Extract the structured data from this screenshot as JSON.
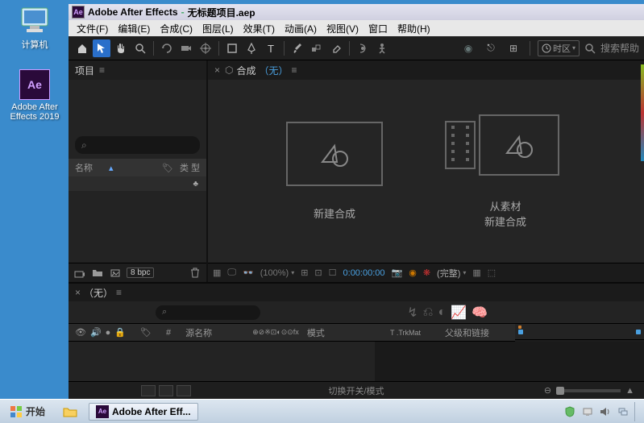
{
  "desktop": {
    "computer_label": "计算机",
    "ae_label": "Adobe After\nEffects 2019"
  },
  "titlebar": {
    "app": "Adobe After Effects",
    "sep": "-",
    "file": "无标题项目.aep"
  },
  "menu": {
    "file": "文件(F)",
    "edit": "编辑(E)",
    "composition": "合成(C)",
    "layer": "图层(L)",
    "effect": "效果(T)",
    "animation": "动画(A)",
    "view": "视图(V)",
    "window": "窗口",
    "help": "帮助(H)"
  },
  "toolbar": {
    "search_help": "搜索帮助",
    "clock_label": "时区"
  },
  "project": {
    "tab": "项目",
    "hamburger": "≡",
    "search_icon": "⌕",
    "col_name": "名称",
    "col_type": "类 型",
    "bpc": "8 bpc"
  },
  "comp": {
    "tab_prefix": "合成",
    "none": "（无）",
    "hamburger": "≡",
    "new_comp": "新建合成",
    "from_footage_l1": "从素材",
    "from_footage_l2": "新建合成",
    "zoom": "(100%)",
    "timecode": "0:00:00:00",
    "wanzheng": "(完整)"
  },
  "timeline": {
    "tab": "（无）",
    "hamburger": "≡",
    "col1": "#",
    "col_source": "源名称",
    "col_mode": "模式",
    "col_trk": "T .TrkMat",
    "col_parent": "父级和链接",
    "switch_label": "切换开关/模式"
  },
  "taskbar": {
    "start": "开始",
    "task_ae": "Adobe After Eff..."
  }
}
